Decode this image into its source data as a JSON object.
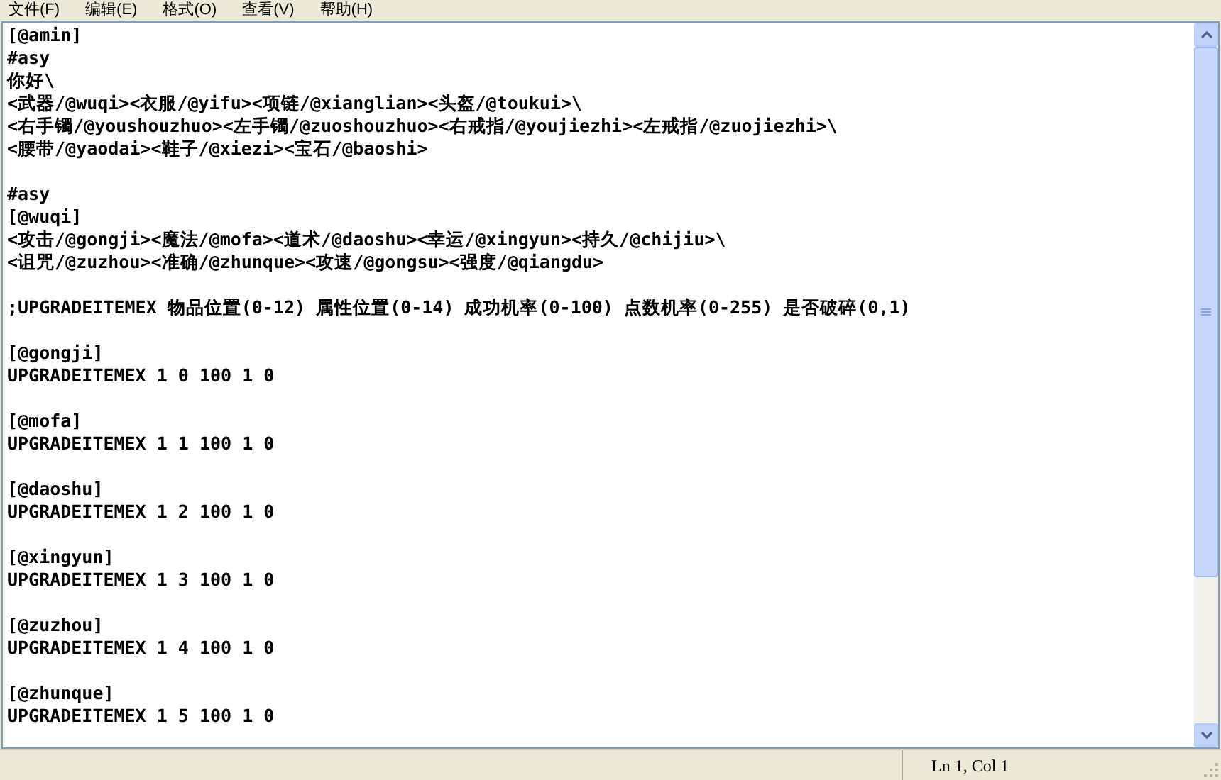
{
  "menu": [
    {
      "label": "文件(F)"
    },
    {
      "label": "编辑(E)"
    },
    {
      "label": "格式(O)"
    },
    {
      "label": "查看(V)"
    },
    {
      "label": "帮助(H)"
    }
  ],
  "blocks": [
    [
      "[@amin]",
      "#asy",
      "你好\\",
      "<武器/@wuqi><衣服/@yifu><项链/@xianglian><头盔/@toukui>\\",
      "<右手镯/@youshouzhuo><左手镯/@zuoshouzhuo><右戒指/@youjiezhi><左戒指/@zuojiezhi>\\",
      "<腰带/@yaodai><鞋子/@xiezi><宝石/@baoshi>"
    ],
    [
      "#asy",
      "[@wuqi]",
      "<攻击/@gongji><魔法/@mofa><道术/@daoshu><幸运/@xingyun><持久/@chijiu>\\",
      "<诅咒/@zuzhou><准确/@zhunque><攻速/@gongsu><强度/@qiangdu>"
    ],
    [
      ";UPGRADEITEMEX 物品位置(0-12) 属性位置(0-14) 成功机率(0-100) 点数机率(0-255) 是否破碎(0,1)"
    ],
    [
      "[@gongji]",
      "UPGRADEITEMEX 1 0 100 1 0"
    ],
    [
      "[@mofa]",
      "UPGRADEITEMEX 1 1 100 1 0"
    ],
    [
      "[@daoshu]",
      "UPGRADEITEMEX 1 2 100 1 0"
    ],
    [
      "[@xingyun]",
      "UPGRADEITEMEX 1 3 100 1 0"
    ],
    [
      "[@zuzhou]",
      "UPGRADEITEMEX 1 4 100 1 0"
    ],
    [
      "[@zhunque]",
      "UPGRADEITEMEX 1 5 100 1 0"
    ]
  ],
  "status_bar": {
    "position": "Ln 1, Col 1"
  }
}
